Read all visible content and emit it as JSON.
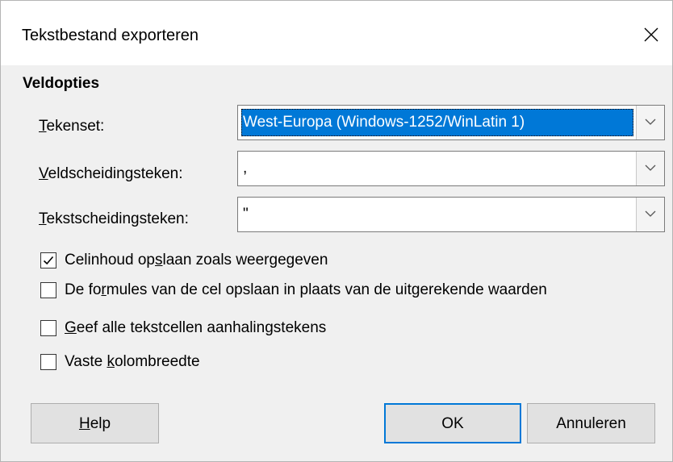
{
  "window": {
    "title": "Tekstbestand exporteren"
  },
  "section": {
    "heading": "Veldopties"
  },
  "fields": {
    "charset": {
      "label_mnemonic": "T",
      "label_rest": "ekenset:",
      "value": "West-Europa (Windows-1252/WinLatin 1)"
    },
    "field_delimiter": {
      "label_mnemonic": "V",
      "label_rest": "eldscheidingsteken:",
      "value": ","
    },
    "string_delimiter": {
      "label_mnemonic": "T",
      "label_rest": "ekstscheidingsteken:",
      "value": "\""
    }
  },
  "options": [
    {
      "pre": "Celinhoud op",
      "mnemonic": "s",
      "post": "laan zoals weergegeven",
      "checked": true
    },
    {
      "pre": "De fo",
      "mnemonic": "r",
      "post": "mules van de cel opslaan in plaats van de uitgerekende waarden",
      "checked": false
    },
    {
      "pre": "",
      "mnemonic": "G",
      "post": "eef alle tekstcellen aanhalingstekens",
      "checked": false
    },
    {
      "pre": "Vaste ",
      "mnemonic": "k",
      "post": "olombreedte",
      "checked": false
    }
  ],
  "buttons": {
    "help": {
      "mnemonic": "H",
      "rest": "elp"
    },
    "ok": "OK",
    "cancel": "Annuleren"
  },
  "colors": {
    "selection": "#0078d7",
    "default_button_border": "#0078d7",
    "dialog_background": "#f0f0f0"
  }
}
